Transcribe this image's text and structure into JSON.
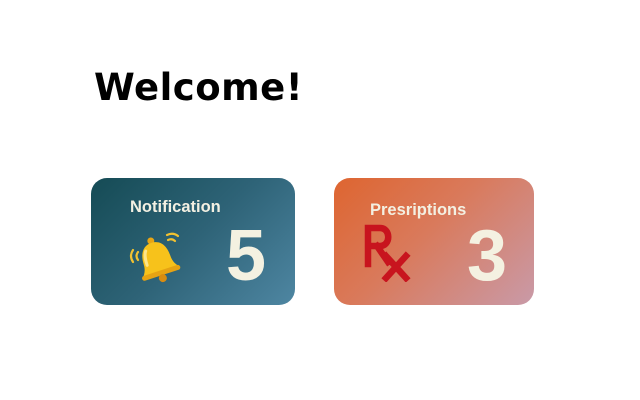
{
  "header": {
    "title": "Welcome!"
  },
  "cards": [
    {
      "label": "Notification",
      "count": "5",
      "icon": "bell-icon"
    },
    {
      "label": "Presriptions",
      "count": "3",
      "icon": "rx-icon"
    }
  ],
  "colors": {
    "notification_gradient_start": "#154b55",
    "notification_gradient_end": "#4e86a2",
    "prescription_gradient_start": "#de6530",
    "prescription_gradient_end": "#c99aa8",
    "card_text": "#f3f0e2",
    "rx_red": "#c8141e",
    "bell_yellow": "#f7c21b"
  }
}
